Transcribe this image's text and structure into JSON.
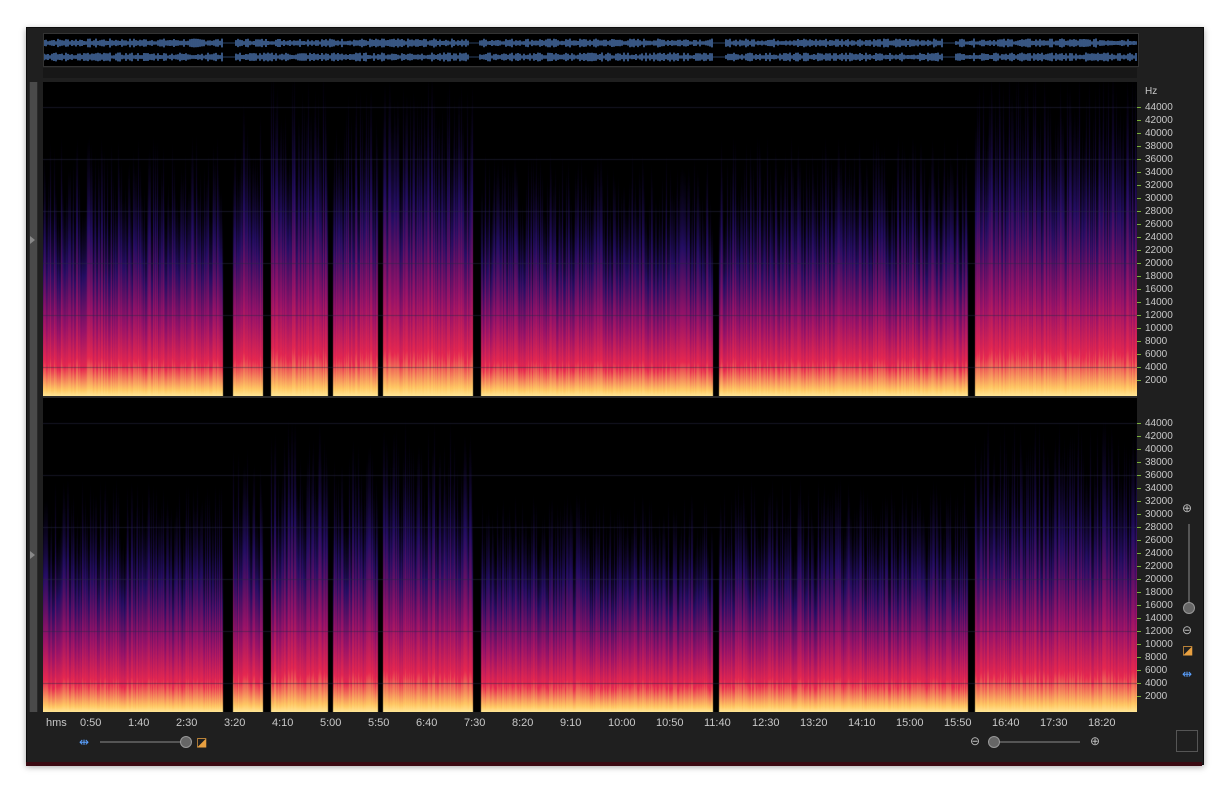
{
  "freq_axis": {
    "unit": "Hz",
    "labels": [
      "44000",
      "42000",
      "40000",
      "38000",
      "36000",
      "34000",
      "32000",
      "30000",
      "28000",
      "26000",
      "24000",
      "22000",
      "20000",
      "18000",
      "16000",
      "14000",
      "12000",
      "10000",
      "8000",
      "6000",
      "4000",
      "2000"
    ]
  },
  "time_axis": {
    "unit": "hms",
    "labels": [
      "0:50",
      "1:40",
      "2:30",
      "3:20",
      "4:10",
      "5:00",
      "5:50",
      "6:40",
      "7:30",
      "8:20",
      "9:10",
      "10:00",
      "10:50",
      "11:40",
      "12:30",
      "13:20",
      "14:10",
      "15:00",
      "15:50",
      "16:40",
      "17:30",
      "18:20"
    ]
  },
  "icons": {
    "playhead": "playhead-icon",
    "color_ramp": "color-ramp-icon",
    "zoom_in": "zoom-in-icon",
    "zoom_out": "zoom-out-icon"
  },
  "colors": {
    "background": "#1f1f1f",
    "waveform": "#5c8ed8",
    "spectrum_low": "#1a0a3a",
    "spectrum_mid": "#c01a6a",
    "spectrum_high": "#ffd070",
    "axis_tick": "#7ab03a"
  }
}
